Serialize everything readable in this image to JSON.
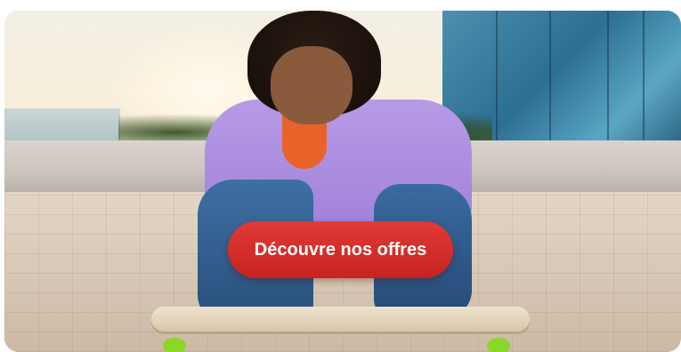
{
  "banner": {
    "cta_label": "Découvre nos offres",
    "cta_color": "#d22b27",
    "cta_text_color": "#ffffff",
    "image_alt": ""
  }
}
